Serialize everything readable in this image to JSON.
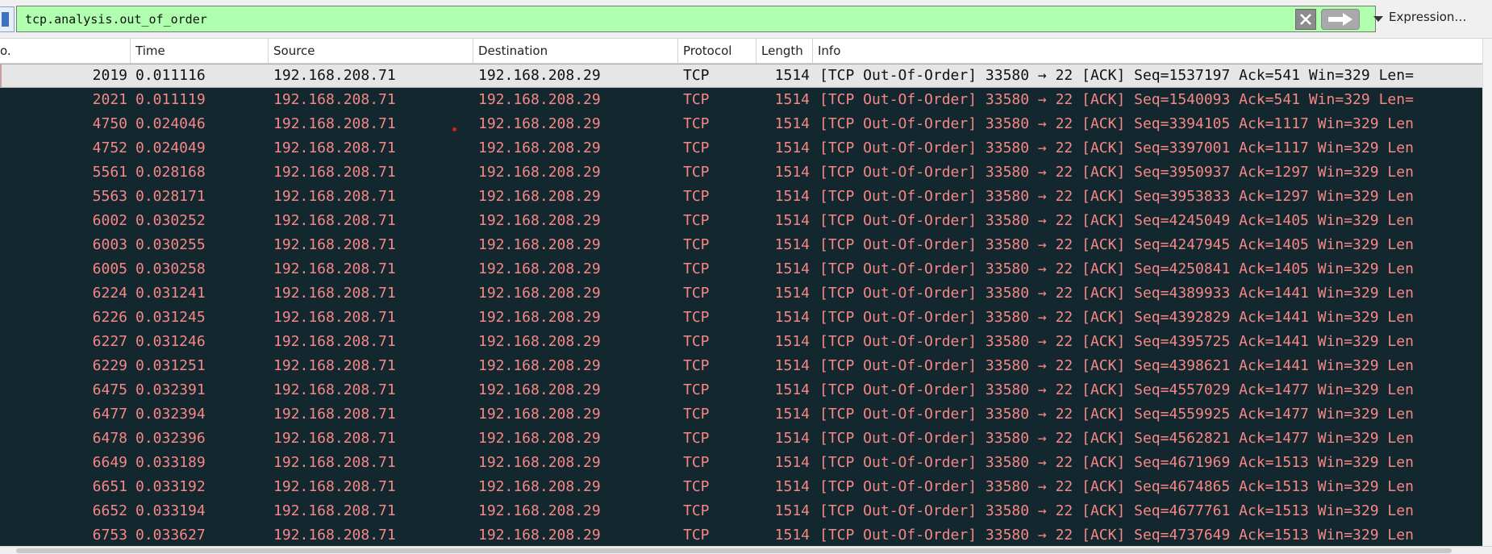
{
  "filter": {
    "value": "tcp.analysis.out_of_order",
    "expression_label": "Expression…"
  },
  "columns": {
    "no": "o.",
    "time": "Time",
    "source": "Source",
    "destination": "Destination",
    "protocol": "Protocol",
    "length": "Length",
    "info": "Info"
  },
  "colors": {
    "filter_valid_bg": "#afffaf",
    "row_bg": "#12272e",
    "row_fg": "#f78787",
    "selected_bg": "#e6e6e6"
  },
  "packets": [
    {
      "no": "2019",
      "time": "0.011116",
      "source": "192.168.208.71",
      "destination": "192.168.208.29",
      "protocol": "TCP",
      "length": "1514",
      "info": "[TCP Out-Of-Order] 33580 → 22 [ACK] Seq=1537197 Ack=541 Win=329 Len=",
      "selected": true
    },
    {
      "no": "2021",
      "time": "0.011119",
      "source": "192.168.208.71",
      "destination": "192.168.208.29",
      "protocol": "TCP",
      "length": "1514",
      "info": "[TCP Out-Of-Order] 33580 → 22 [ACK] Seq=1540093 Ack=541 Win=329 Len="
    },
    {
      "no": "4750",
      "time": "0.024046",
      "source": "192.168.208.71",
      "destination": "192.168.208.29",
      "protocol": "TCP",
      "length": "1514",
      "info": "[TCP Out-Of-Order] 33580 → 22 [ACK] Seq=3394105 Ack=1117 Win=329 Len"
    },
    {
      "no": "4752",
      "time": "0.024049",
      "source": "192.168.208.71",
      "destination": "192.168.208.29",
      "protocol": "TCP",
      "length": "1514",
      "info": "[TCP Out-Of-Order] 33580 → 22 [ACK] Seq=3397001 Ack=1117 Win=329 Len"
    },
    {
      "no": "5561",
      "time": "0.028168",
      "source": "192.168.208.71",
      "destination": "192.168.208.29",
      "protocol": "TCP",
      "length": "1514",
      "info": "[TCP Out-Of-Order] 33580 → 22 [ACK] Seq=3950937 Ack=1297 Win=329 Len"
    },
    {
      "no": "5563",
      "time": "0.028171",
      "source": "192.168.208.71",
      "destination": "192.168.208.29",
      "protocol": "TCP",
      "length": "1514",
      "info": "[TCP Out-Of-Order] 33580 → 22 [ACK] Seq=3953833 Ack=1297 Win=329 Len"
    },
    {
      "no": "6002",
      "time": "0.030252",
      "source": "192.168.208.71",
      "destination": "192.168.208.29",
      "protocol": "TCP",
      "length": "1514",
      "info": "[TCP Out-Of-Order] 33580 → 22 [ACK] Seq=4245049 Ack=1405 Win=329 Len"
    },
    {
      "no": "6003",
      "time": "0.030255",
      "source": "192.168.208.71",
      "destination": "192.168.208.29",
      "protocol": "TCP",
      "length": "1514",
      "info": "[TCP Out-Of-Order] 33580 → 22 [ACK] Seq=4247945 Ack=1405 Win=329 Len"
    },
    {
      "no": "6005",
      "time": "0.030258",
      "source": "192.168.208.71",
      "destination": "192.168.208.29",
      "protocol": "TCP",
      "length": "1514",
      "info": "[TCP Out-Of-Order] 33580 → 22 [ACK] Seq=4250841 Ack=1405 Win=329 Len"
    },
    {
      "no": "6224",
      "time": "0.031241",
      "source": "192.168.208.71",
      "destination": "192.168.208.29",
      "protocol": "TCP",
      "length": "1514",
      "info": "[TCP Out-Of-Order] 33580 → 22 [ACK] Seq=4389933 Ack=1441 Win=329 Len"
    },
    {
      "no": "6226",
      "time": "0.031245",
      "source": "192.168.208.71",
      "destination": "192.168.208.29",
      "protocol": "TCP",
      "length": "1514",
      "info": "[TCP Out-Of-Order] 33580 → 22 [ACK] Seq=4392829 Ack=1441 Win=329 Len"
    },
    {
      "no": "6227",
      "time": "0.031246",
      "source": "192.168.208.71",
      "destination": "192.168.208.29",
      "protocol": "TCP",
      "length": "1514",
      "info": "[TCP Out-Of-Order] 33580 → 22 [ACK] Seq=4395725 Ack=1441 Win=329 Len"
    },
    {
      "no": "6229",
      "time": "0.031251",
      "source": "192.168.208.71",
      "destination": "192.168.208.29",
      "protocol": "TCP",
      "length": "1514",
      "info": "[TCP Out-Of-Order] 33580 → 22 [ACK] Seq=4398621 Ack=1441 Win=329 Len"
    },
    {
      "no": "6475",
      "time": "0.032391",
      "source": "192.168.208.71",
      "destination": "192.168.208.29",
      "protocol": "TCP",
      "length": "1514",
      "info": "[TCP Out-Of-Order] 33580 → 22 [ACK] Seq=4557029 Ack=1477 Win=329 Len"
    },
    {
      "no": "6477",
      "time": "0.032394",
      "source": "192.168.208.71",
      "destination": "192.168.208.29",
      "protocol": "TCP",
      "length": "1514",
      "info": "[TCP Out-Of-Order] 33580 → 22 [ACK] Seq=4559925 Ack=1477 Win=329 Len"
    },
    {
      "no": "6478",
      "time": "0.032396",
      "source": "192.168.208.71",
      "destination": "192.168.208.29",
      "protocol": "TCP",
      "length": "1514",
      "info": "[TCP Out-Of-Order] 33580 → 22 [ACK] Seq=4562821 Ack=1477 Win=329 Len"
    },
    {
      "no": "6649",
      "time": "0.033189",
      "source": "192.168.208.71",
      "destination": "192.168.208.29",
      "protocol": "TCP",
      "length": "1514",
      "info": "[TCP Out-Of-Order] 33580 → 22 [ACK] Seq=4671969 Ack=1513 Win=329 Len"
    },
    {
      "no": "6651",
      "time": "0.033192",
      "source": "192.168.208.71",
      "destination": "192.168.208.29",
      "protocol": "TCP",
      "length": "1514",
      "info": "[TCP Out-Of-Order] 33580 → 22 [ACK] Seq=4674865 Ack=1513 Win=329 Len"
    },
    {
      "no": "6652",
      "time": "0.033194",
      "source": "192.168.208.71",
      "destination": "192.168.208.29",
      "protocol": "TCP",
      "length": "1514",
      "info": "[TCP Out-Of-Order] 33580 → 22 [ACK] Seq=4677761 Ack=1513 Win=329 Len"
    },
    {
      "no": "6753",
      "time": "0.033627",
      "source": "192.168.208.71",
      "destination": "192.168.208.29",
      "protocol": "TCP",
      "length": "1514",
      "info": "[TCP Out-Of-Order] 33580 → 22 [ACK] Seq=4737649 Ack=1513 Win=329 Len"
    }
  ]
}
